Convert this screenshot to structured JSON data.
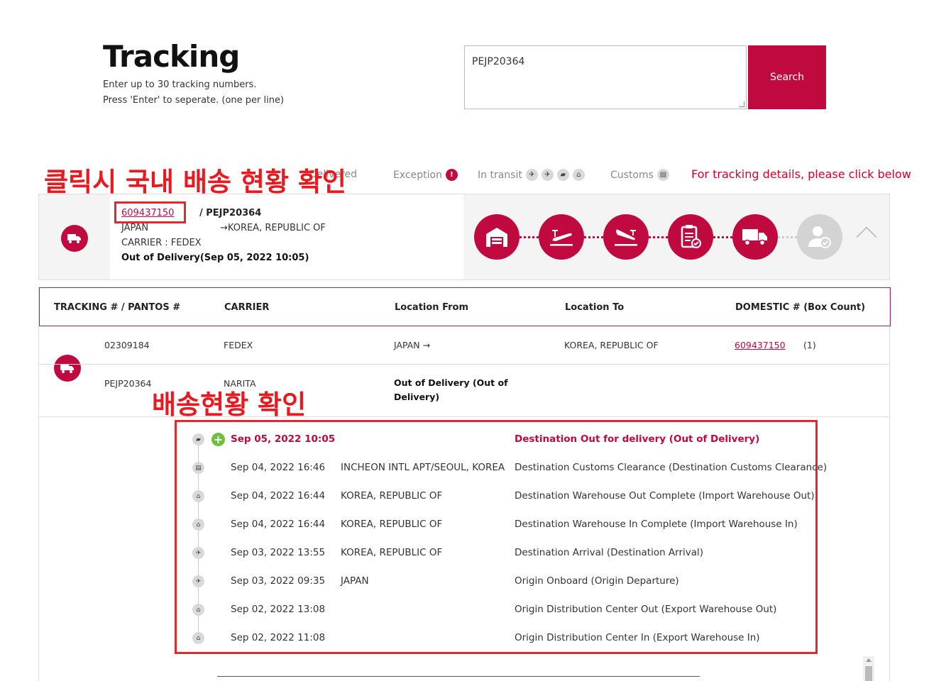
{
  "header": {
    "title": "Tracking",
    "line1": "Enter up to 30 tracking numbers.",
    "line2": "Press 'Enter' to seperate. (one per line)"
  },
  "search": {
    "value": "PEJP20364",
    "button_label": "Search"
  },
  "legend": {
    "delivered_label": "Delivered",
    "exception_label": "Exception",
    "exception_mark": "!",
    "in_transit_label": "In transit",
    "customs_label": "Customs",
    "note": "For tracking details, please click below"
  },
  "annotations": {
    "domestic_check": "클릭시 국내 배송 현황 확인",
    "status_check": "배송현황 확인"
  },
  "summary": {
    "domestic_number": "609437150",
    "pantos_number": "/ PEJP20364",
    "from": "JAPAN",
    "to": "→KOREA, REPUBLIC OF",
    "carrier": "CARRIER : FEDEX",
    "status": "Out of Delivery(Sep 05, 2022 10:05)"
  },
  "table": {
    "headers": {
      "tracking": "TRACKING # / PANTOS #",
      "carrier": "CARRIER",
      "location_from": "Location From",
      "location_to": "Location To",
      "domestic": "DOMESTIC # (Box Count)"
    },
    "row1": {
      "tracking": "02309184",
      "carrier": "FEDEX",
      "from": "JAPAN →",
      "to": "KOREA, REPUBLIC OF",
      "domestic": "609437150",
      "box_count": "(1)"
    },
    "row2": {
      "pantos": "PEJP20364",
      "carrier": "NARITA",
      "status_line1": "Out of Delivery    (Out of",
      "status_line2": "Delivery)"
    }
  },
  "timeline": [
    {
      "date": "Sep 05, 2022 10:05",
      "location": "",
      "description": "Destination Out for delivery (Out of Delivery)",
      "icon": "truck-icon",
      "active": true
    },
    {
      "date": "Sep 04, 2022 16:46",
      "location": "INCHEON INTL APT/SEOUL, KOREA",
      "description": "Destination Customs Clearance (Destination Customs Clearance)",
      "icon": "customs-icon",
      "active": false
    },
    {
      "date": "Sep 04, 2022 16:44",
      "location": "KOREA, REPUBLIC OF",
      "description": "Destination Warehouse Out Complete (Import Warehouse Out)",
      "icon": "warehouse-icon",
      "active": false
    },
    {
      "date": "Sep 04, 2022 16:44",
      "location": "KOREA, REPUBLIC OF",
      "description": "Destination Warehouse In Complete (Import Warehouse In)",
      "icon": "warehouse-icon",
      "active": false
    },
    {
      "date": "Sep 03, 2022 13:55",
      "location": "KOREA, REPUBLIC OF",
      "description": "Destination Arrival (Destination Arrival)",
      "icon": "plane-landing-icon",
      "active": false
    },
    {
      "date": "Sep 03, 2022 09:35",
      "location": "JAPAN",
      "description": "Origin Onboard (Origin Departure)",
      "icon": "plane-takeoff-icon",
      "active": false
    },
    {
      "date": "Sep 02, 2022 13:08",
      "location": "",
      "description": "Origin Distribution Center Out (Export Warehouse Out)",
      "icon": "warehouse-icon",
      "active": false
    },
    {
      "date": "Sep 02, 2022 11:08",
      "location": "",
      "description": "Origin Distribution Center In (Export Warehouse In)",
      "icon": "warehouse-icon",
      "active": false
    }
  ],
  "colors": {
    "brand": "#c0093f",
    "annotation": "#e0282e",
    "plus": "#6dbf3d"
  }
}
